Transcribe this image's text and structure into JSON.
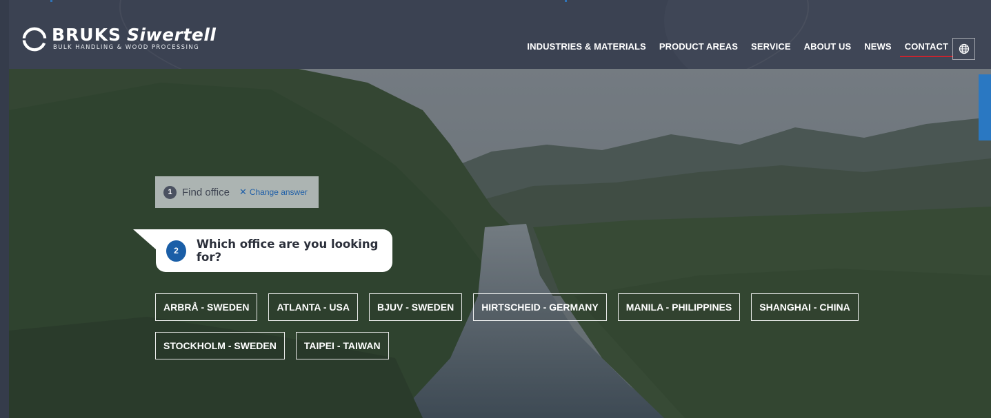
{
  "brand": {
    "name_main": "BRUKS",
    "name_script": "Siwertell",
    "tagline": "BULK HANDLING & WOOD PROCESSING"
  },
  "nav": {
    "items": [
      {
        "label": "INDUSTRIES & MATERIALS",
        "active": false
      },
      {
        "label": "PRODUCT AREAS",
        "active": false
      },
      {
        "label": "SERVICE",
        "active": false
      },
      {
        "label": "ABOUT US",
        "active": false
      },
      {
        "label": "NEWS",
        "active": false
      },
      {
        "label": "CONTACT",
        "active": true
      }
    ],
    "language_icon": "globe-icon"
  },
  "step1": {
    "number": "1",
    "label": "Find office",
    "change_label": "Change answer",
    "change_icon": "close-icon"
  },
  "step2": {
    "number": "2",
    "question": "Which office are you looking for?"
  },
  "offices": {
    "row1": [
      "ARBRÅ - SWEDEN",
      "ATLANTA - USA",
      "BJUV - SWEDEN",
      "HIRTSCHEID - GERMANY",
      "MANILA - PHILIPPINES",
      "SHANGHAI - CHINA"
    ],
    "row2": [
      "STOCKHOLM - SWEDEN",
      "TAIPEI - TAIWAN"
    ]
  },
  "colors": {
    "header_bg": "#3b4252",
    "accent_blue": "#1a5ea7",
    "active_underline": "#c8242f"
  }
}
